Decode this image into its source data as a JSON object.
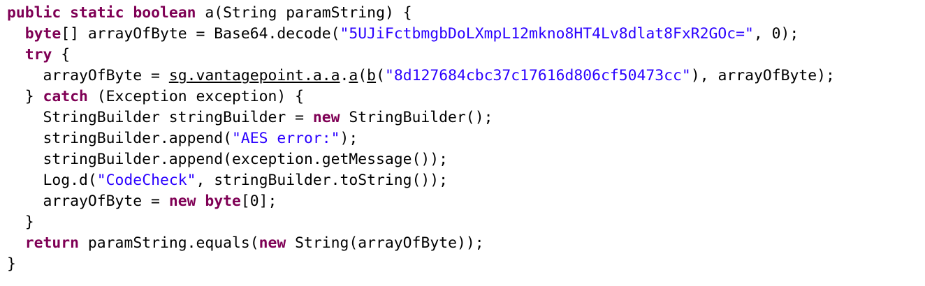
{
  "code_view": {
    "cut_off_top_text": "",
    "lines": [
      {
        "parts": [
          {
            "t": "public",
            "k": "kw"
          },
          {
            "t": " "
          },
          {
            "t": "static",
            "k": "kw"
          },
          {
            "t": " "
          },
          {
            "t": "boolean",
            "k": "kw"
          },
          {
            "t": " a(String paramString) {"
          }
        ]
      },
      {
        "parts": [
          {
            "t": "  "
          },
          {
            "t": "byte",
            "k": "kw"
          },
          {
            "t": "[] arrayOfByte = Base64.decode("
          },
          {
            "t": "\"5UJiFctbmgbDoLXmpL12mkno8HT4Lv8dlat8FxR2GOc=\"",
            "k": "str"
          },
          {
            "t": ", 0);"
          }
        ]
      },
      {
        "parts": [
          {
            "t": "  "
          },
          {
            "t": "try",
            "k": "kw"
          },
          {
            "t": " {"
          }
        ]
      },
      {
        "parts": [
          {
            "t": "    arrayOfByte = "
          },
          {
            "t": "sg.vantagepoint.a.a",
            "k": "u"
          },
          {
            "t": "."
          },
          {
            "t": "a",
            "k": "u"
          },
          {
            "t": "("
          },
          {
            "t": "b",
            "k": "u"
          },
          {
            "t": "("
          },
          {
            "t": "\"8d127684cbc37c17616d806cf50473cc\"",
            "k": "str"
          },
          {
            "t": "), arrayOfByte);"
          }
        ]
      },
      {
        "parts": [
          {
            "t": "  } "
          },
          {
            "t": "catch",
            "k": "kw"
          },
          {
            "t": " (Exception exception) {"
          }
        ]
      },
      {
        "parts": [
          {
            "t": "    StringBuilder stringBuilder = "
          },
          {
            "t": "new",
            "k": "kw"
          },
          {
            "t": " StringBuilder();"
          }
        ]
      },
      {
        "parts": [
          {
            "t": "    stringBuilder.append("
          },
          {
            "t": "\"AES error:\"",
            "k": "str"
          },
          {
            "t": ");"
          }
        ]
      },
      {
        "parts": [
          {
            "t": "    stringBuilder.append(exception.getMessage());"
          }
        ]
      },
      {
        "parts": [
          {
            "t": "    Log.d("
          },
          {
            "t": "\"CodeCheck\"",
            "k": "str"
          },
          {
            "t": ", stringBuilder.toString());"
          }
        ]
      },
      {
        "parts": [
          {
            "t": "    arrayOfByte = "
          },
          {
            "t": "new",
            "k": "kw"
          },
          {
            "t": " "
          },
          {
            "t": "byte",
            "k": "kw"
          },
          {
            "t": "[0];"
          }
        ]
      },
      {
        "parts": [
          {
            "t": "  }"
          }
        ]
      },
      {
        "parts": [
          {
            "t": "  "
          },
          {
            "t": "return",
            "k": "kw"
          },
          {
            "t": " paramString.equals("
          },
          {
            "t": "new",
            "k": "kw"
          },
          {
            "t": " String(arrayOfByte));"
          }
        ]
      },
      {
        "parts": [
          {
            "t": "}"
          }
        ]
      }
    ]
  },
  "colors": {
    "background": "#ffffff",
    "keyword": "#7f0055",
    "string": "#2a00ff",
    "text": "#000000"
  }
}
